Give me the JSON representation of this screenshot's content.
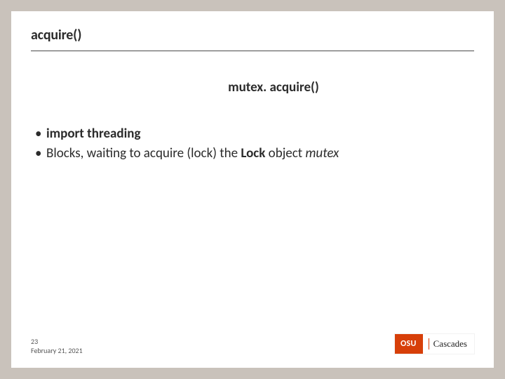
{
  "title": "acquire()",
  "subtitle": "mutex. acquire()",
  "bullets": {
    "b0": {
      "bold": "import threading"
    },
    "b1": {
      "pre": "Blocks, waiting to acquire (lock) the ",
      "bold": "Lock",
      "mid": " object ",
      "ital": "mutex"
    }
  },
  "footer": {
    "page": "23",
    "date": "February 21, 2021"
  },
  "logo": {
    "abbr": "OSU",
    "campus": "Cascades"
  }
}
